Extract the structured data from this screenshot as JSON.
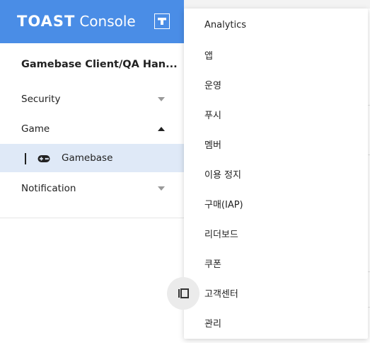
{
  "brand": {
    "logo_primary": "TOAST",
    "logo_secondary": "Console",
    "color": "#4a8de6"
  },
  "sidebar": {
    "project_title": "Gamebase Client/QA Han...",
    "items": [
      {
        "label": "Security",
        "state": "collapsed"
      },
      {
        "label": "Game",
        "state": "expanded"
      },
      {
        "label": "Notification",
        "state": "collapsed"
      }
    ],
    "sub_items": [
      {
        "label": "Gamebase",
        "icon": "gamepad-icon",
        "selected": true
      }
    ],
    "selected_bg": "#dfe9f7"
  },
  "dropdown": {
    "items": [
      "Analytics",
      "앱",
      "운영",
      "푸시",
      "멤버",
      "이용 정지",
      "구매(IAP)",
      "리더보드",
      "쿠폰",
      "고객센터",
      "관리"
    ]
  }
}
